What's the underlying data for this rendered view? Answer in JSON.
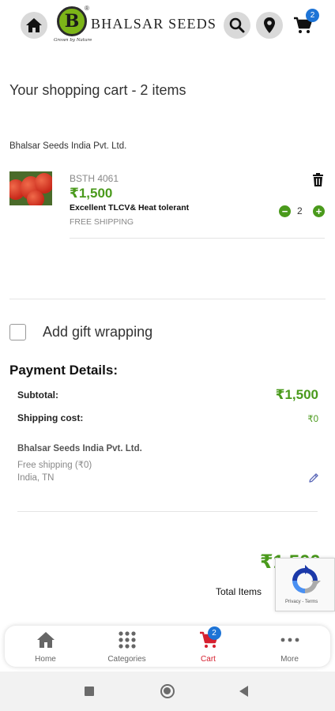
{
  "header": {
    "brand_name": "BHALSAR SEEDS",
    "brand_mark": "B",
    "brand_tagline": "Grown by Nature",
    "brand_registered": "®",
    "cart_count": "2",
    "icons": [
      "home-icon",
      "search-icon",
      "location-pin-icon",
      "cart-icon"
    ]
  },
  "cart": {
    "title": "Your shopping cart - 2 items",
    "seller": "Bhalsar Seeds India Pvt. Ltd.",
    "items": [
      {
        "sku": "BSTH 4061",
        "price": "₹1,500",
        "description": "Excellent TLCV& Heat tolerant",
        "shipping": "FREE SHIPPING",
        "quantity": "2",
        "minus": "−",
        "plus": "+"
      }
    ]
  },
  "gift": {
    "label": "Add gift wrapping",
    "checked": false
  },
  "payment": {
    "title": "Payment Details:",
    "subtotal_label": "Subtotal:",
    "subtotal_value": "₹1,500",
    "shipping_label": "Shipping cost:",
    "shipping_value": "₹0",
    "address_name": "Bhalsar Seeds India Pvt. Ltd.",
    "address_shipping": "Free shipping (₹0)",
    "address_location": "India, TN"
  },
  "totals": {
    "total_value": "₹1,500",
    "total_items_label": "Total Items"
  },
  "recaptcha": {
    "links": "Privacy - Terms"
  },
  "bottom_nav": {
    "items": [
      {
        "label": "Home",
        "icon": "home-icon"
      },
      {
        "label": "Categories",
        "icon": "grid-icon"
      },
      {
        "label": "Cart",
        "icon": "cart-icon",
        "badge": "2",
        "active": true
      },
      {
        "label": "More",
        "icon": "more-dots-icon"
      }
    ]
  },
  "colors": {
    "accent_green": "#4a9a1c",
    "badge_blue": "#1e74d6",
    "active_red": "#d6202f",
    "logo_green": "#7cb518"
  }
}
